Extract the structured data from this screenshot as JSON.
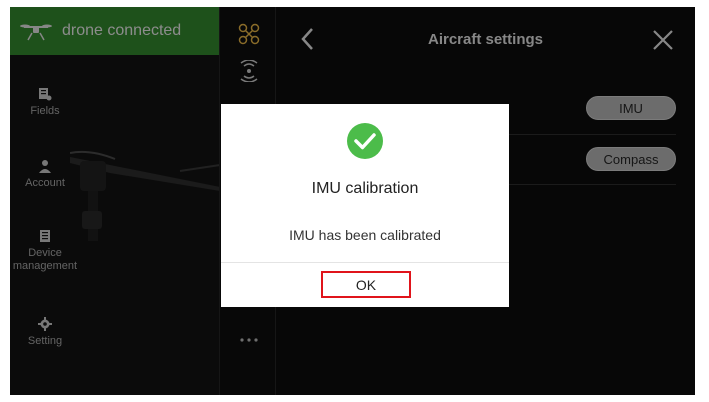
{
  "connection": {
    "status_text": "drone connected",
    "color": "#2f7d2a"
  },
  "sidebar": {
    "items": [
      {
        "label": "Fields",
        "icon": "fields-icon"
      },
      {
        "label": "Account",
        "icon": "account-icon"
      },
      {
        "label": "Device\nmanagement",
        "icon": "device-management-icon"
      },
      {
        "label": "Setting",
        "icon": "gear-icon"
      }
    ]
  },
  "panel": {
    "title": "Aircraft settings",
    "buttons": {
      "imu": "IMU",
      "compass": "Compass"
    }
  },
  "dialog": {
    "title": "IMU calibration",
    "message": "IMU has been calibrated",
    "ok_label": "OK",
    "success_color": "#4cbc4a",
    "highlight_color": "#e0141b"
  }
}
